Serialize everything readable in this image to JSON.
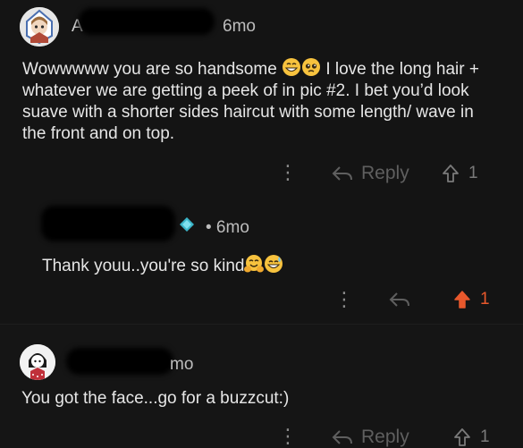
{
  "comments": [
    {
      "author_initial": "A",
      "age": "6mo",
      "text": "Wowwwww you are so handsome",
      "text2": " I love the long hair + whatever we are getting a peek of in pic #2. I bet you’d look suave with a shorter sides haircut with some length/ wave in the front and on top.",
      "reply_label": "Reply",
      "upvotes": "1",
      "emojis": [
        "grinning-face",
        "pleading-face"
      ]
    },
    {
      "age": "• 6mo",
      "text": "Thank youu..you're so kind",
      "upvotes": "1",
      "emojis": [
        "hugging-face",
        "smiling-sweat-face"
      ]
    },
    {
      "age": "mo",
      "text": "You got the face...go for a buzzcut:)",
      "reply_label": "Reply",
      "upvotes": "1"
    }
  ],
  "colors": {
    "background": "#141414",
    "text": "#e6e6e6",
    "muted": "#6d6d6d",
    "upvote_active": "#e8582c",
    "badge": "#3bb5c9"
  }
}
